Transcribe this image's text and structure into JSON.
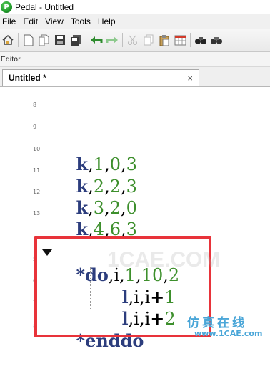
{
  "window": {
    "title": "Pedal - Untitled",
    "app_icon_letter": "P"
  },
  "menu": {
    "items": [
      "File",
      "Edit",
      "View",
      "Tools",
      "Help"
    ]
  },
  "toolbar": {
    "buttons": [
      "open-icon",
      "new-file-icon",
      "copy-file-icon",
      "save-icon",
      "save-all-icon",
      "undo-icon",
      "redo-icon",
      "cut-icon",
      "copy-icon",
      "paste-icon",
      "table-icon",
      "find-icon",
      "find-replace-icon"
    ]
  },
  "panel": {
    "title": "Editor"
  },
  "tab": {
    "label": "Untitled *",
    "close": "×"
  },
  "editor": {
    "line_numbers": [
      "8",
      "9",
      "10",
      "11",
      "12",
      "13",
      "5",
      "6",
      "7",
      "8"
    ],
    "lines": [
      {
        "kw": "k",
        "rest": [
          ",",
          "1",
          ",",
          "0",
          ",",
          "3"
        ]
      },
      {
        "kw": "k",
        "rest": [
          ",",
          "2",
          ",",
          "2",
          ",",
          "3"
        ]
      },
      {
        "kw": "k",
        "rest": [
          ",",
          "3",
          ",",
          "2",
          ",",
          "0"
        ]
      },
      {
        "kw": "k",
        "rest": [
          ",",
          "4",
          ",",
          "6",
          ",",
          "3"
        ]
      }
    ],
    "do_line": {
      "kw": "*do",
      "text1": ",i,",
      "n1": "1",
      "c": ",",
      "n2": "10",
      "c2": ",",
      "n3": "2"
    },
    "l_line1": {
      "kw": "l",
      "text": ",i,i",
      "op": "+",
      "n": "1"
    },
    "l_line2": {
      "kw": "l",
      "text": ",i,i",
      "op": "+",
      "n": "2"
    },
    "enddo": "*enddo"
  },
  "watermark": {
    "cn": "仿真在线",
    "url": "www.1CAE.com",
    "faint": "1CAE.COM"
  }
}
